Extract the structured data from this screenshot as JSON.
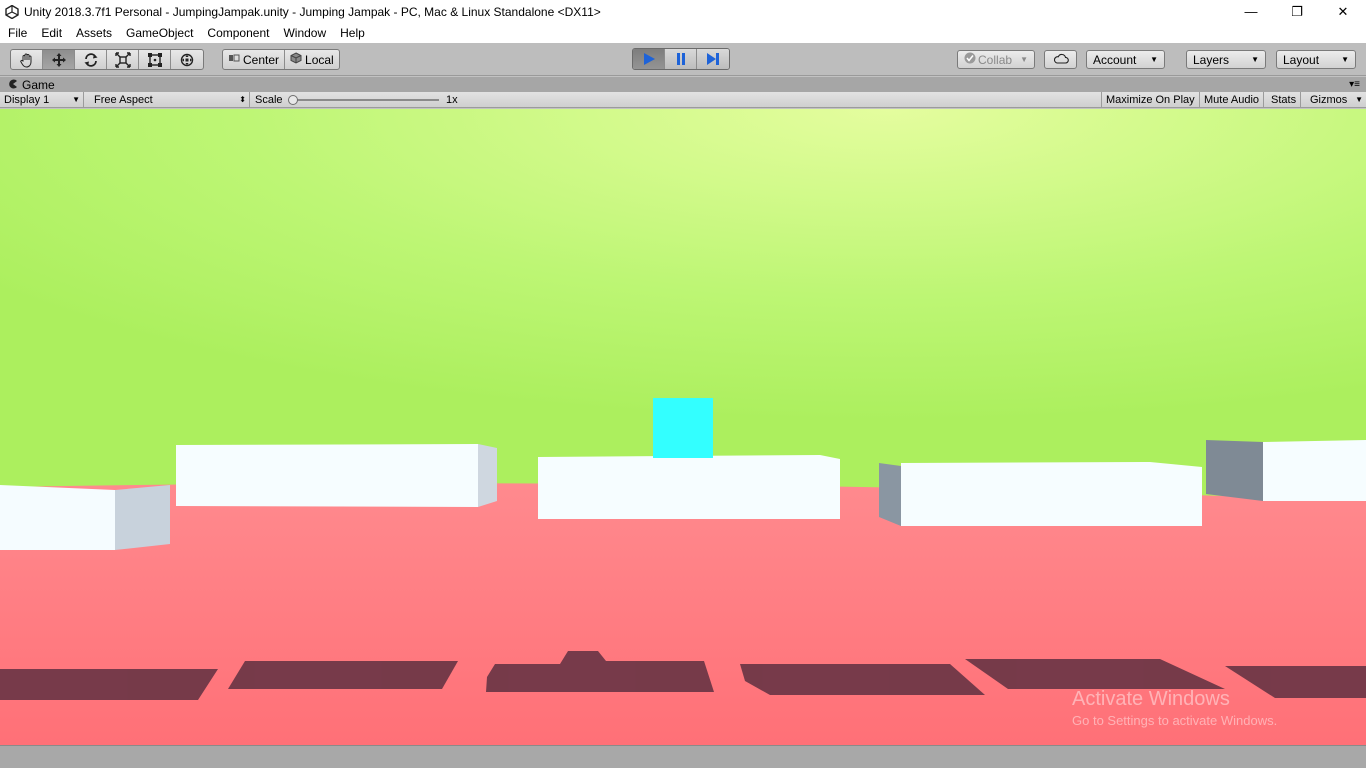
{
  "window": {
    "title": "Unity 2018.3.7f1 Personal - JumpingJampak.unity - Jumping Jampak - PC, Mac & Linux Standalone <DX11>",
    "controls": {
      "minimize": "—",
      "restore": "❐",
      "close": "✕"
    }
  },
  "menu": [
    "File",
    "Edit",
    "Assets",
    "GameObject",
    "Component",
    "Window",
    "Help"
  ],
  "toolbar": {
    "tools": [
      "hand-tool",
      "move-tool",
      "rotate-tool",
      "scale-tool",
      "rect-tool",
      "transform-tool"
    ],
    "active_tool": "move-tool",
    "pivot_label": "Center",
    "space_label": "Local",
    "play_active": true,
    "collab_label": "Collab",
    "account_label": "Account",
    "layers_label": "Layers",
    "layout_label": "Layout"
  },
  "game_tab": {
    "title": "Game",
    "display": "Display 1",
    "aspect": "Free Aspect",
    "scale_label": "Scale",
    "scale_value": "1x",
    "scale_level": 0.0,
    "maximize_on_play": "Maximize On Play",
    "mute_audio": "Mute Audio",
    "stats": "Stats",
    "gizmos": "Gizmos"
  },
  "watermark": {
    "title": "Activate Windows",
    "subtitle": "Go to Settings to activate Windows."
  },
  "colors": {
    "sky_top": "#e0fc9a",
    "sky": "#b3f46a",
    "ground": "#ff7a80",
    "platform": "#f5fcff",
    "platform_side": "#c5ced8",
    "player": "#33ffff",
    "shadow": "#6b3545",
    "accent_play": "#1e63d8"
  }
}
